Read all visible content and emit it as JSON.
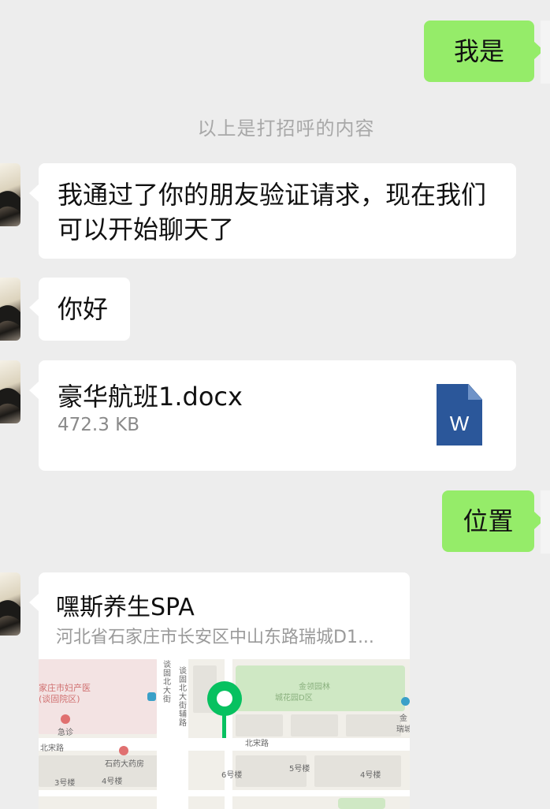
{
  "messages": {
    "greeting_reply": "我是",
    "system_note": "以上是打招呼的内容",
    "verify_text": "我通过了你的朋友验证请求，现在我们可以开始聊天了",
    "hello_text": "你好",
    "file": {
      "name": "豪华航班1.docx",
      "size": "472.3 KB",
      "type_icon": "word-doc-icon",
      "type_letter": "W"
    },
    "location_reply": "位置",
    "location": {
      "title": "嘿斯养生SPA",
      "address": "河北省石家庄市长安区中山东路瑞城D1...",
      "map_labels": {
        "hospital": "家庄市妇产医",
        "hospital_district": "(谈固院区)",
        "emergency": "急诊",
        "pharmacy": "石药大药房",
        "north_song_rd_left": "北宋路",
        "north_song_rd_right": "北宋路",
        "garden": "金领园林",
        "garden_sub": "城花园D区",
        "building_4": "4号楼",
        "building_3": "3号楼",
        "building_6": "6号楼",
        "building_5": "5号楼",
        "building_4b": "4号楼",
        "ruicheng": "金",
        "ruicheng2": "瑞城",
        "street_1": "谈固北大街",
        "street_2": "谈固北大街辅路"
      }
    }
  },
  "colors": {
    "background": "#ededed",
    "outgoing_bubble": "#95ec69",
    "incoming_bubble": "#ffffff",
    "system_text": "#a8a8a8",
    "pin": "#07c160",
    "word_blue": "#2b579a"
  }
}
